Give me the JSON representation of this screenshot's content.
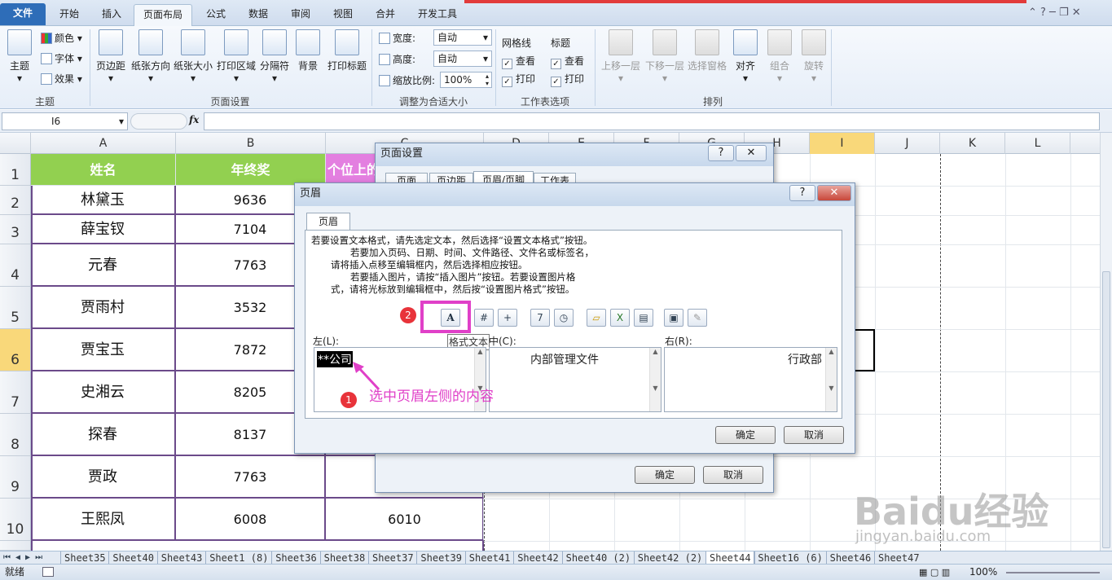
{
  "ribbon_tabs": [
    "文件",
    "开始",
    "插入",
    "页面布局",
    "公式",
    "数据",
    "审阅",
    "视图",
    "合并",
    "开发工具"
  ],
  "ribbon": {
    "theme": {
      "label": "主题",
      "color": "颜色",
      "font": "字体",
      "effect": "效果",
      "group": "主题"
    },
    "page_setup": {
      "margins": "页边距",
      "orientation": "纸张方向",
      "size": "纸张大小",
      "print_area": "打印区域",
      "breaks": "分隔符",
      "background": "背景",
      "print_titles": "打印标题",
      "group": "页面设置"
    },
    "scale": {
      "width_label": "宽度:",
      "width_value": "自动",
      "height_label": "高度:",
      "height_value": "自动",
      "scale_label": "缩放比例:",
      "scale_value": "100%",
      "group": "调整为合适大小"
    },
    "sheet_options": {
      "gridlines": "网格线",
      "headings": "标题",
      "view": "查看",
      "print": "打印",
      "group": "工作表选项"
    },
    "arrange": {
      "bring_forward": "上移一层",
      "send_backward": "下移一层",
      "selection_pane": "选择窗格",
      "align": "对齐",
      "group_btn": "组合",
      "rotate": "旋转",
      "group": "排列"
    }
  },
  "formula_bar": {
    "name_box": "I6",
    "fx": "fx"
  },
  "columns": [
    "A",
    "B",
    "C",
    "D",
    "E",
    "F",
    "G",
    "H",
    "I",
    "J",
    "K",
    "L"
  ],
  "rows": [
    "1",
    "2",
    "3",
    "4",
    "5",
    "6",
    "7",
    "8",
    "9",
    "10"
  ],
  "table": {
    "headers": [
      "姓名",
      "年终奖",
      "个位上的"
    ],
    "rows": [
      [
        "林黛玉",
        "9636"
      ],
      [
        "薛宝钗",
        "7104"
      ],
      [
        "元春",
        "7763"
      ],
      [
        "贾雨村",
        "3532"
      ],
      [
        "贾宝玉",
        "7872"
      ],
      [
        "史湘云",
        "8205"
      ],
      [
        "探春",
        "8137"
      ],
      [
        "贾政",
        "7763"
      ],
      [
        "王熙凤",
        "6008",
        "6010"
      ]
    ]
  },
  "page_setup_dialog": {
    "title": "页面设置",
    "tabs": [
      "页面",
      "页边距",
      "页眉/页脚",
      "工作表"
    ],
    "ok": "确定",
    "cancel": "取消"
  },
  "header_dialog": {
    "title": "页眉",
    "help": "?",
    "close": "✕",
    "tab": "页眉",
    "instructions": [
      "若要设置文本格式，请先选定文本，然后选择“设置文本格式”按钮。",
      "若要加入页码、日期、时间、文件路径、文件名或标签名，",
      "请将插入点移至编辑框内，然后选择相应按钮。",
      "若要插入图片，请按“插入图片”按钮。若要设置图片格",
      "式，请将光标放到编辑框中，然后按“设置图片格式”按钮。"
    ],
    "left_label": "左(L):",
    "center_label": "中(C):",
    "right_label": "右(R):",
    "left_text": "**公司",
    "center_text": "内部管理文件",
    "right_text": "行政部",
    "tooltip": "格式文本",
    "ok": "确定",
    "cancel": "取消"
  },
  "annotations": {
    "step1": "1",
    "step2": "2",
    "note": "选中页眉左侧的内容",
    "accent": "#e040c8"
  },
  "sheet_tabs": [
    "Sheet35",
    "Sheet40",
    "Sheet43",
    "Sheet1 (8)",
    "Sheet36",
    "Sheet38",
    "Sheet37",
    "Sheet39",
    "Sheet41",
    "Sheet42",
    "Sheet40 (2)",
    "Sheet42 (2)",
    "Sheet44",
    "Sheet16 (6)",
    "Sheet46",
    "Sheet47"
  ],
  "active_sheet": "Sheet44",
  "status": {
    "ready": "就绪",
    "zoom": "100%"
  },
  "watermark": {
    "brand": "Baidu经验",
    "url": "jingyan.baidu.com"
  }
}
